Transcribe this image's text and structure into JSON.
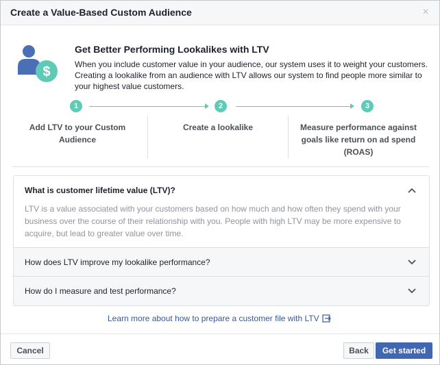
{
  "dialog": {
    "title": "Create a Value-Based Custom Audience",
    "close_icon": "×"
  },
  "hero": {
    "icon": "person-dollar-icon",
    "title": "Get Better Performing Lookalikes with LTV",
    "description": "When you include customer value in your audience, our system uses it to weight your customers. Creating a lookalike from an audience with LTV allows our system to find people more similar to your highest value customers."
  },
  "steps": [
    {
      "number": "1",
      "label": "Add LTV to your Custom Audience"
    },
    {
      "number": "2",
      "label": "Create a lookalike"
    },
    {
      "number": "3",
      "label": "Measure performance against goals like return on ad spend (ROAS)"
    }
  ],
  "faq": {
    "open_item": {
      "title": "What is customer lifetime value (LTV)?",
      "body": "LTV is a value associated with your customers based on how much and how often they spend with your business over the course of their relationship with you. People with high LTV may be more expensive to acquire, but lead to greater value over time."
    },
    "items": [
      {
        "title": "How does LTV improve my lookalike performance?"
      },
      {
        "title": "How do I measure and test performance?"
      }
    ]
  },
  "learn_more": {
    "label": "Learn more about how to prepare a customer file with LTV"
  },
  "footer": {
    "cancel_label": "Cancel",
    "back_label": "Back",
    "primary_label": "Get started"
  },
  "colors": {
    "accent_teal": "#5fcbb6",
    "primary_blue": "#4267b2",
    "link_blue": "#365899",
    "icon_blue": "#4a6fb5"
  }
}
